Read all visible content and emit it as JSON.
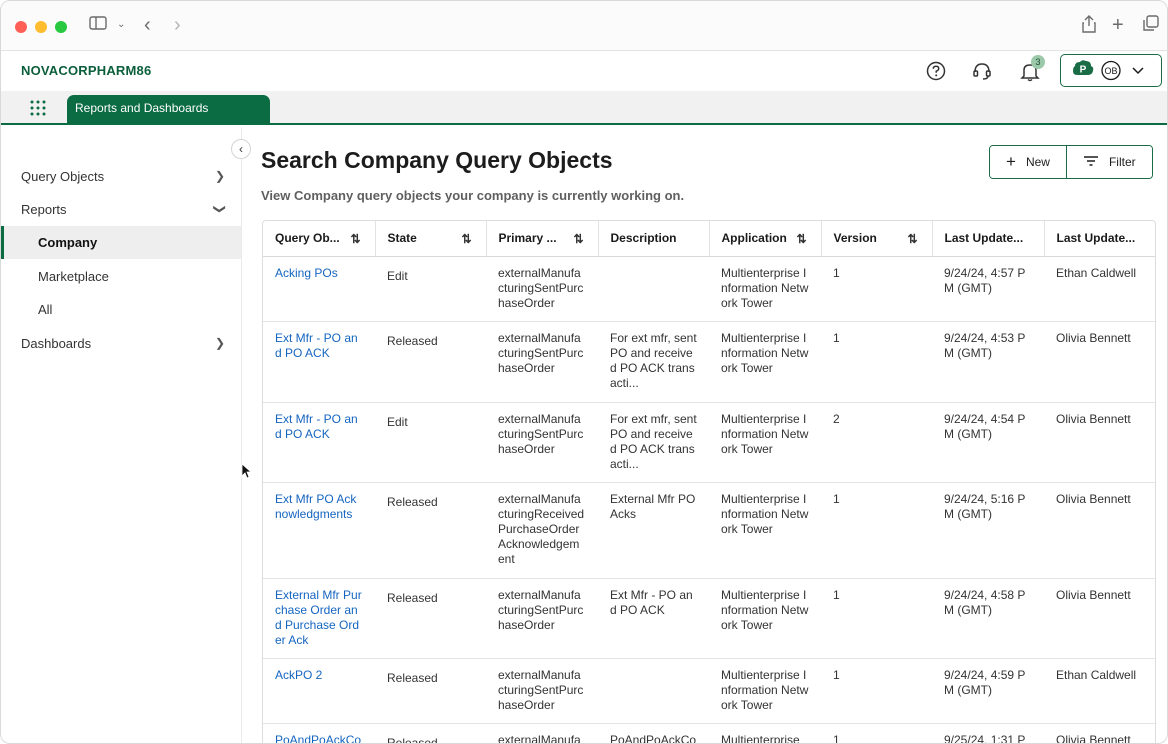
{
  "header": {
    "brand": "NOVACORPHARM86",
    "notification_count": "3",
    "account_letter": "P",
    "account_initials": "OB"
  },
  "tabs": [
    {
      "label": "Reports and Dashboards",
      "active": true
    }
  ],
  "sidebar": {
    "items": [
      {
        "label": "Query Objects"
      },
      {
        "label": "Reports"
      },
      {
        "label": "Company"
      },
      {
        "label": "Marketplace"
      },
      {
        "label": "All"
      },
      {
        "label": "Dashboards"
      }
    ]
  },
  "main": {
    "title": "Search Company Query Objects",
    "subtitle": "View Company query objects your company is currently working on.",
    "new_label": "New",
    "filter_label": "Filter"
  },
  "table": {
    "columns": [
      "Query Ob...",
      "State",
      "Primary ...",
      "Description",
      "Application",
      "Version",
      "Last Update...",
      "Last Update..."
    ],
    "rows": [
      {
        "name": "Acking POs",
        "state": "Edit",
        "primary": "externalManufacturingSentPurchaseOrder",
        "description": "",
        "application": "Multienterprise Information Network Tower",
        "version": "1",
        "updated": "9/24/24, 4:57 PM (GMT)",
        "updated_by": "Ethan Caldwell"
      },
      {
        "name": "Ext Mfr - PO and PO ACK",
        "state": "Released",
        "primary": "externalManufacturingSentPurchaseOrder",
        "description": "For ext mfr, sent PO and received PO ACK transacti...",
        "application": "Multienterprise Information Network Tower",
        "version": "1",
        "updated": "9/24/24, 4:53 PM (GMT)",
        "updated_by": "Olivia Bennett"
      },
      {
        "name": "Ext Mfr - PO and PO ACK",
        "state": "Edit",
        "primary": "externalManufacturingSentPurchaseOrder",
        "description": "For ext mfr, sent PO and received PO ACK transacti...",
        "application": "Multienterprise Information Network Tower",
        "version": "2",
        "updated": "9/24/24, 4:54 PM (GMT)",
        "updated_by": "Olivia Bennett"
      },
      {
        "name": "Ext Mfr PO Acknowledgments",
        "state": "Released",
        "primary": "externalManufacturingReceivedPurchaseOrderAcknowledgement",
        "description": "External Mfr PO Acks",
        "application": "Multienterprise Information Network Tower",
        "version": "1",
        "updated": "9/24/24, 5:16 PM (GMT)",
        "updated_by": "Olivia Bennett"
      },
      {
        "name": "External Mfr Purchase Order and Purchase Order Ack",
        "state": "Released",
        "primary": "externalManufacturingSentPurchaseOrder",
        "description": "Ext Mfr - PO and PO ACK",
        "application": "Multienterprise Information Network Tower",
        "version": "1",
        "updated": "9/24/24, 4:58 PM (GMT)",
        "updated_by": "Olivia Bennett"
      },
      {
        "name": "AckPO 2",
        "state": "Released",
        "primary": "externalManufacturingSentPurchaseOrder",
        "description": "",
        "application": "Multienterprise Information Network Tower",
        "version": "1",
        "updated": "9/24/24, 4:59 PM (GMT)",
        "updated_by": "Ethan Caldwell"
      },
      {
        "name": "PoAndPoAckCo",
        "state": "Released",
        "primary": "externalManufa",
        "description": "PoAndPoAckCo",
        "application": "Multienterprise",
        "version": "1",
        "updated": "9/25/24, 1:31 P",
        "updated_by": "Olivia Bennett"
      }
    ]
  },
  "colors": {
    "brand_green": "#0b6b43",
    "link_blue": "#1565c0"
  }
}
